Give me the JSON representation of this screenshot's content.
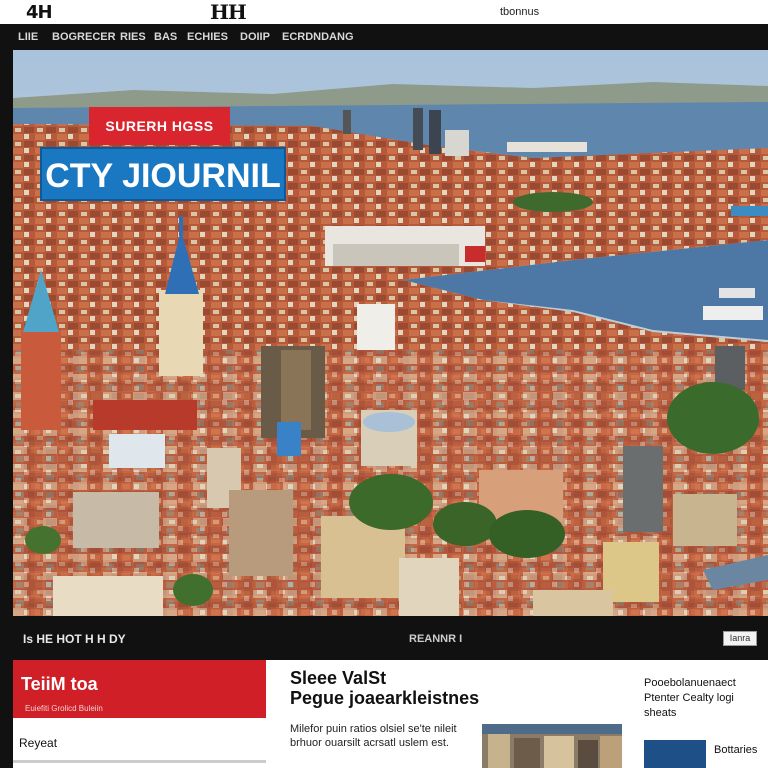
{
  "header": {
    "logo_left": "4H",
    "logo_center": "HH",
    "right_text": "tbonnus"
  },
  "nav": {
    "items": [
      "LIIE",
      "BOGRECER",
      "RIES",
      "BAS",
      "ECHIES",
      "DOIIP",
      "ECRDNDANG"
    ]
  },
  "hero": {
    "tag": "SURERH HGSS",
    "title": "CTY JIOURNIL"
  },
  "ticker": {
    "left_text": "Is HE HOT H H DY",
    "mid_text": "REANNR I",
    "button": "Ianra"
  },
  "sidebar_box": {
    "title": "TeiiM toa",
    "subtitle": "Euiefiti Grolicd Buleiin"
  },
  "col1_link": "Reyeat",
  "article": {
    "headline1": "Sleee ValSt",
    "headline2": "Pegue joaearkleistnes",
    "body": "Milefor puin ratios olsiel se'te nileit brhuor ouarsilt acrsatl uslem est."
  },
  "side_article": {
    "text": "Pooebolanuenaect Ptenter Cealty logi sheats",
    "label": "Bottaries"
  },
  "colors": {
    "red_accent": "#d01f27",
    "blue_accent": "#1a78c2",
    "dark_bar": "#111111"
  }
}
